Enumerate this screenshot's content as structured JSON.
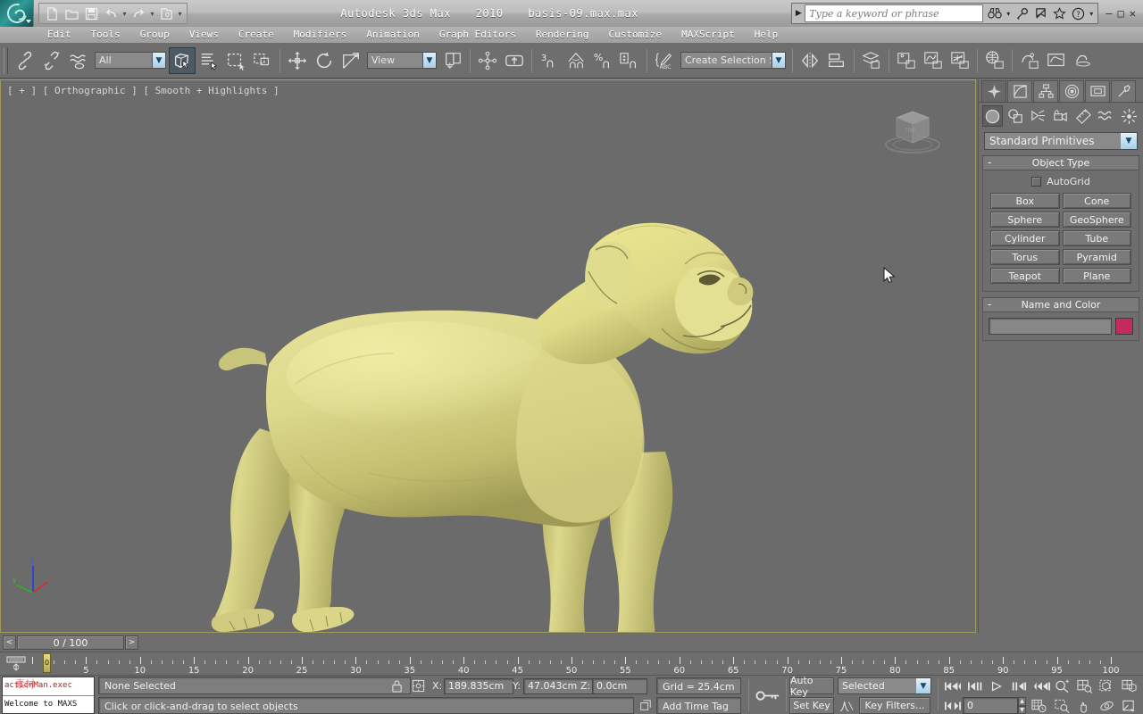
{
  "titlebar": {
    "app_name": "Autodesk 3ds Max",
    "version": "2010",
    "file_name": "basis-09.max.max",
    "quick_access": [
      "new-file-icon",
      "open-file-icon",
      "save-file-icon",
      "undo-icon",
      "undo-dropdown-icon",
      "redo-icon",
      "redo-dropdown-icon",
      "project-folder-icon",
      "qat-more-icon"
    ],
    "search_placeholder": "Type a keyword or phrase",
    "infocenter_icons": [
      "binoculars-icon",
      "binoculars-dropdown-icon",
      "subscription-key-icon",
      "communication-center-icon",
      "favorites-star-icon",
      "help-question-icon",
      "help-dropdown-icon"
    ],
    "window_buttons": {
      "minimize": "—",
      "maximize": "□",
      "close": "✕"
    }
  },
  "menubar": {
    "items": [
      "Edit",
      "Tools",
      "Group",
      "Views",
      "Create",
      "Modifiers",
      "Animation",
      "Graph Editors",
      "Rendering",
      "Customize",
      "MAXScript",
      "Help"
    ]
  },
  "toolbar": {
    "selection_filter": "All",
    "reference_coordinate_system": "View",
    "named_selection_sets": "Create Selection Set",
    "buttons": [
      "select-and-link-icon",
      "unlink-selection-icon",
      "bind-to-space-warp-icon",
      "select-object-icon",
      "select-by-name-icon",
      "rectangular-selection-region-icon",
      "window-crossing-icon",
      "select-and-move-icon",
      "select-and-rotate-icon",
      "select-and-scale-icon",
      "use-pivot-point-center-icon",
      "select-and-manipulate-icon",
      "snaps-toggle-3-icon",
      "angle-snap-toggle-icon",
      "percent-snap-toggle-icon",
      "spinner-snap-toggle-icon",
      "edit-named-selection-sets-icon",
      "mirror-icon",
      "align-icon",
      "layer-manager-icon",
      "curve-editor-icon",
      "schematic-view-icon",
      "material-editor-icon",
      "render-setup-icon",
      "rendered-frame-window-icon",
      "render-production-icon",
      "render-iterative-icon",
      "activeshade-icon"
    ]
  },
  "viewport": {
    "label": "[ + ] [ Orthographic ] [ Smooth + Highlights ]",
    "background_color": "#6b6b6b",
    "model_name": "dog-mesh",
    "model_color": "#ddd98a",
    "viewcube_label": "TOP",
    "axis_tripod": {
      "x_label": "x",
      "y_label": "y",
      "z_label": "z",
      "x_color": "#cc3333",
      "y_color": "#33aa33",
      "z_color": "#3344cc"
    }
  },
  "command_panel": {
    "tabs": [
      "create-tab-icon",
      "modify-tab-icon",
      "hierarchy-tab-icon",
      "motion-tab-icon",
      "display-tab-icon",
      "utilities-tab-icon"
    ],
    "active_tab": 0,
    "categories": [
      "geometry-category-icon",
      "shapes-category-icon",
      "lights-category-icon",
      "cameras-category-icon",
      "helpers-category-icon",
      "space-warps-category-icon",
      "systems-category-icon"
    ],
    "active_category": 0,
    "subcategory": "Standard Primitives",
    "rollouts": [
      {
        "title": "Object Type",
        "collapse_glyph": "-",
        "autogrid_label": "AutoGrid",
        "autogrid_checked": false,
        "buttons": [
          "Box",
          "Cone",
          "Sphere",
          "GeoSphere",
          "Cylinder",
          "Tube",
          "Torus",
          "Pyramid",
          "Teapot",
          "Plane"
        ]
      },
      {
        "title": "Name and Color",
        "collapse_glyph": "-",
        "name_value": "",
        "color_swatch": "#c52a5e"
      }
    ]
  },
  "time_slider": {
    "prev_glyph": "<",
    "next_glyph": ">",
    "current": "0 / 100",
    "frame_start": 0,
    "frame_end": 100,
    "tick_labels": [
      5,
      10,
      15,
      20,
      25,
      30,
      35,
      40,
      45,
      50,
      55,
      60,
      65,
      70,
      75,
      80,
      85,
      90,
      95,
      100
    ],
    "handle_label": "0"
  },
  "status_bar": {
    "maxscript_listener": {
      "top_line": "actionMan.exec",
      "bottom_line": "Welcome to MAXS"
    },
    "selection_status": "None Selected",
    "prompt": "Click or click-and-drag to select objects",
    "lock_icon": "selection-lock-icon",
    "transform_icon": "absolute-mode-transform-icon",
    "coordinates": [
      {
        "label": "X:",
        "value": "189.835cm"
      },
      {
        "label": "Y:",
        "value": "47.043cm"
      },
      {
        "label": "Z:",
        "value": "0.0cm"
      }
    ],
    "grid_text": "Grid = 25.4cm",
    "add_time_tag": "Add Time Tag",
    "key_mode_icon": "key-mode-toggle-icon",
    "auto_key": "Auto Key",
    "set_key": "Set Key",
    "key_filter_set": "Selected",
    "key_filters": "Key Filters...",
    "default_in_out_icon": "default-tangent-icon",
    "playback": [
      "go-to-start-icon",
      "previous-frame-icon",
      "play-animation-icon",
      "next-frame-icon",
      "go-to-end-icon"
    ],
    "key_nav_icon": "key-mode-toggle-nav-icon",
    "current_frame": "0",
    "time_config_icon": "time-configuration-icon",
    "viewport_nav": [
      "zoom-icon",
      "zoom-all-icon",
      "zoom-extents-icon",
      "zoom-extents-all-icon",
      "zoom-region-icon",
      "pan-view-icon",
      "orbit-icon",
      "maximize-viewport-toggle-icon"
    ]
  }
}
